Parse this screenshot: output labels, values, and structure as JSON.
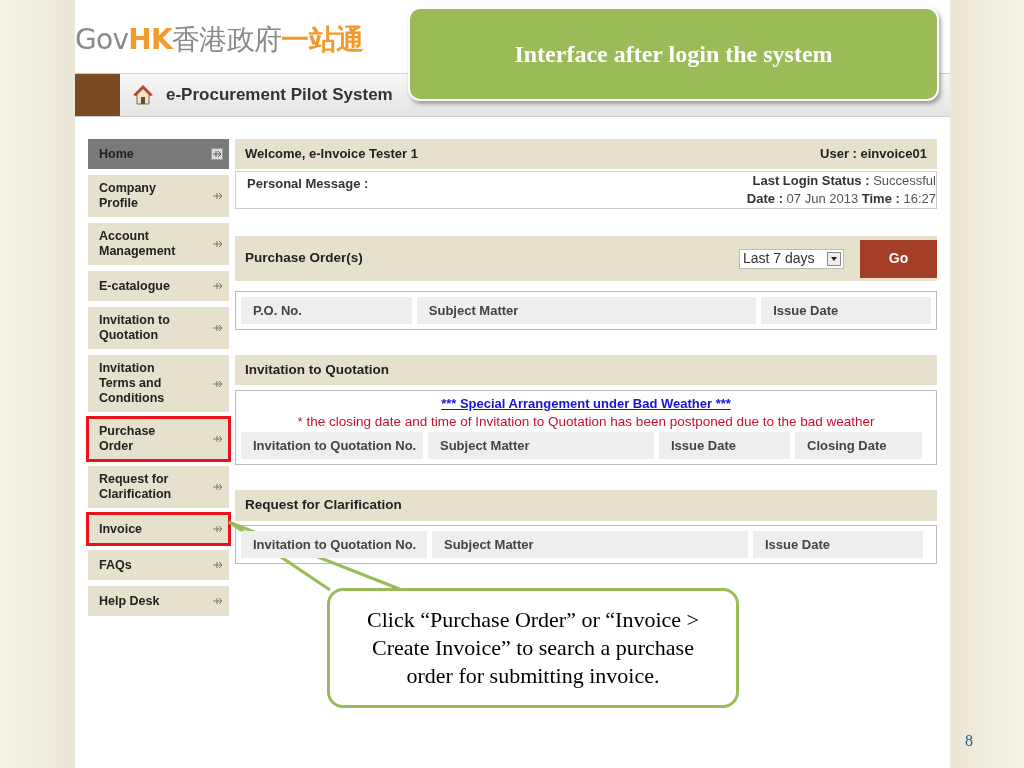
{
  "slide_title": "Interface after login the system",
  "logo": [
    {
      "text": "Gov",
      "color": "#8a8a8a"
    },
    {
      "text": "HK",
      "color": "#f29a2e"
    },
    {
      "text": "香港政府",
      "color": "#8a8a8a"
    },
    {
      "text": "一站通",
      "color": "#f29a2e"
    }
  ],
  "header": {
    "title": "e-Procurement Pilot System"
  },
  "sidebar": {
    "items": [
      {
        "label": "Home",
        "selected": true,
        "highlighted": false
      },
      {
        "label": "Company Profile",
        "selected": false,
        "highlighted": false
      },
      {
        "label": "Account Management",
        "selected": false,
        "highlighted": false
      },
      {
        "label": "E-catalogue",
        "selected": false,
        "highlighted": false
      },
      {
        "label": "Invitation to Quotation",
        "selected": false,
        "highlighted": false
      },
      {
        "label": "Invitation Terms and Conditions",
        "selected": false,
        "highlighted": false
      },
      {
        "label": "Purchase Order",
        "selected": false,
        "highlighted": true
      },
      {
        "label": "Request for Clarification",
        "selected": false,
        "highlighted": false
      },
      {
        "label": "Invoice",
        "selected": false,
        "highlighted": true
      },
      {
        "label": "FAQs",
        "selected": false,
        "highlighted": false
      },
      {
        "label": "Help Desk",
        "selected": false,
        "highlighted": false
      }
    ]
  },
  "welcome": {
    "greeting": "Welcome, e-Invoice Tester 1",
    "user": "User : einvoice01",
    "message_label": "Personal Message :",
    "login_status": "**Last Login Status :** Successful",
    "login_time": "**Date :** 07 Jun 2013 **Time :** 16:27"
  },
  "purchase_orders": {
    "title": "Purchase Order(s)",
    "period": "Last 7 days",
    "go": "Go",
    "columns": [
      "P.O. No.",
      "Subject Matter",
      "Issue Date"
    ]
  },
  "invitation_to_quotation": {
    "title": "Invitation to Quotation",
    "notice_link": "*** Special Arrangement under Bad Weather ***",
    "notice": "* the closing date and time of Invitation to Quotation has been postponed due to the bad weather",
    "columns": [
      "Invitation to Quotation No.",
      "Subject Matter",
      "Issue Date",
      "Closing Date"
    ]
  },
  "request_for_clarification": {
    "title": "Request for Clarification",
    "columns": [
      "Invitation to Quotation No.",
      "Subject Matter",
      "Issue Date"
    ]
  },
  "callout": "Click “Purchase Order” or “Invoice > Create Invoice” to search a purchase order for submitting invoice.",
  "page_number": "8"
}
